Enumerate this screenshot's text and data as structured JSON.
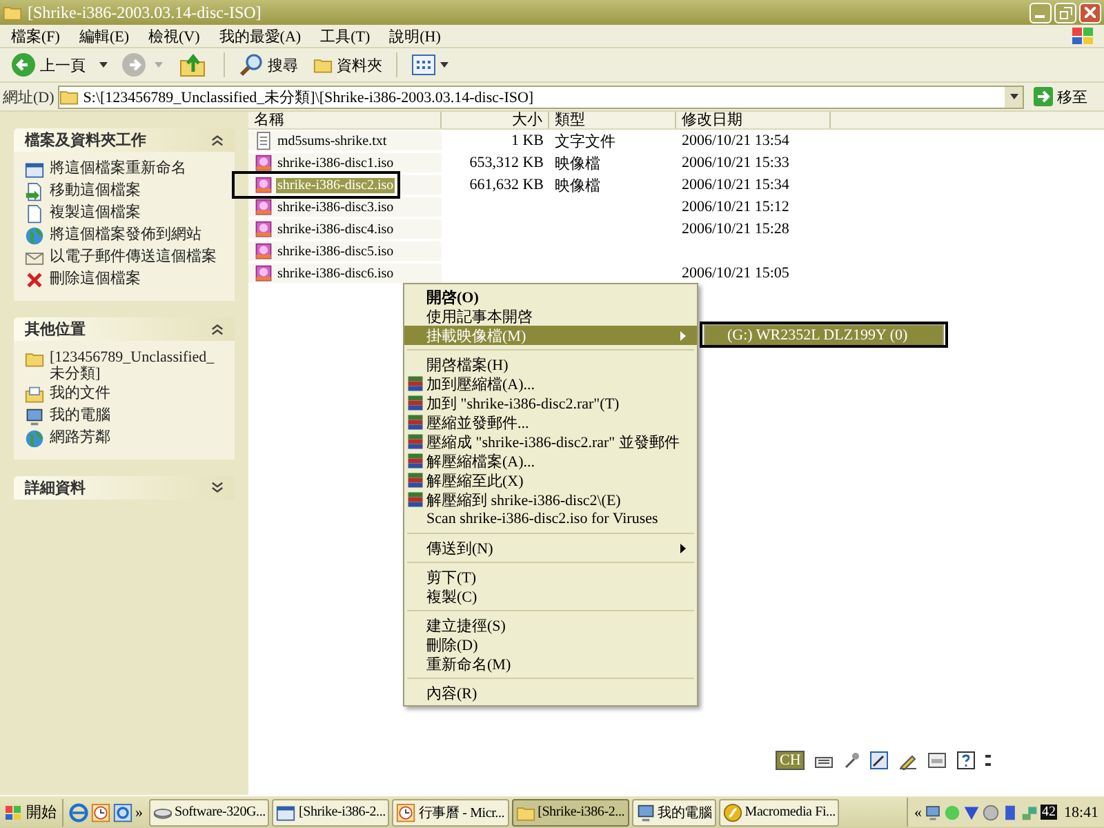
{
  "window": {
    "title": "[Shrike-i386-2003.03.14-disc-ISO]"
  },
  "menu_bar": [
    "檔案(F)",
    "編輯(E)",
    "檢視(V)",
    "我的最愛(A)",
    "工具(T)",
    "說明(H)"
  ],
  "toolbar": {
    "back": "上一頁",
    "search": "搜尋",
    "folders": "資料夾"
  },
  "address_bar": {
    "label": "網址(D)",
    "value": "S:\\[123456789_Unclassified_未分類]\\[Shrike-i386-2003.03.14-disc-ISO]",
    "go": "移至"
  },
  "side_panel": {
    "sections": [
      {
        "title": "檔案及資料夾工作",
        "expanded": true,
        "items": [
          "將這個檔案重新命名",
          "移動這個檔案",
          "複製這個檔案",
          "將這個檔案發佈到網站",
          "以電子郵件傳送這個檔案",
          "刪除這個檔案"
        ]
      },
      {
        "title": "其他位置",
        "expanded": true,
        "items": [
          "[123456789_Unclassified_未分類]",
          "我的文件",
          "我的電腦",
          "網路芳鄰"
        ]
      },
      {
        "title": "詳細資料",
        "expanded": false
      }
    ]
  },
  "file_list": {
    "columns": [
      "名稱",
      "大小",
      "類型",
      "修改日期"
    ],
    "rows": [
      {
        "name": "md5sums-shrike.txt",
        "kind": "text",
        "size": "1 KB",
        "type": "文字文件",
        "modified": "2006/10/21 13:54",
        "selected": false
      },
      {
        "name": "shrike-i386-disc1.iso",
        "kind": "disc-image",
        "size": "653,312 KB",
        "type": "映像檔",
        "modified": "2006/10/21 15:33",
        "selected": false
      },
      {
        "name": "shrike-i386-disc2.iso",
        "kind": "disc-image",
        "size": "661,632 KB",
        "type": "映像檔",
        "modified": "2006/10/21 15:34",
        "selected": true
      },
      {
        "name": "shrike-i386-disc3.iso",
        "kind": "disc-image",
        "modified": "2006/10/21 15:12",
        "selected": false
      },
      {
        "name": "shrike-i386-disc4.iso",
        "kind": "disc-image",
        "modified": "2006/10/21 15:28",
        "selected": false
      },
      {
        "name": "shrike-i386-disc5.iso",
        "kind": "disc-image",
        "selected": false
      },
      {
        "name": "shrike-i386-disc6.iso",
        "kind": "disc-image",
        "modified": "2006/10/21 15:05",
        "selected": false
      }
    ]
  },
  "context_menu": {
    "items": [
      {
        "label": "開啓(O)",
        "kind": "default",
        "selected": false
      },
      {
        "label": "使用記事本開啓",
        "kind": "plain",
        "selected": false
      },
      {
        "label": "掛載映像檔(M)",
        "kind": "submenu",
        "selected": true
      },
      {
        "kind": "separator"
      },
      {
        "label": "開啓檔案(H)",
        "kind": "plain",
        "selected": false
      },
      {
        "label": "加到壓縮檔(A)...",
        "kind": "archive",
        "selected": false
      },
      {
        "label": "加到 \"shrike-i386-disc2.rar\"(T)",
        "kind": "archive",
        "selected": false
      },
      {
        "label": "壓縮並發郵件...",
        "kind": "archive",
        "selected": false
      },
      {
        "label": "壓縮成 \"shrike-i386-disc2.rar\" 並發郵件",
        "kind": "archive",
        "selected": false
      },
      {
        "label": "解壓縮檔案(A)...",
        "kind": "archive",
        "selected": false
      },
      {
        "label": "解壓縮至此(X)",
        "kind": "archive",
        "selected": false
      },
      {
        "label": "解壓縮到 shrike-i386-disc2\\(E)",
        "kind": "archive",
        "selected": false
      },
      {
        "label": "Scan shrike-i386-disc2.iso for Viruses",
        "kind": "plain",
        "selected": false
      },
      {
        "kind": "separator"
      },
      {
        "label": "傳送到(N)",
        "kind": "submenu",
        "selected": false
      },
      {
        "kind": "separator"
      },
      {
        "label": "剪下(T)",
        "kind": "plain",
        "selected": false
      },
      {
        "label": "複製(C)",
        "kind": "plain",
        "selected": false
      },
      {
        "kind": "separator"
      },
      {
        "label": "建立捷徑(S)",
        "kind": "plain",
        "selected": false
      },
      {
        "label": "刪除(D)",
        "kind": "plain",
        "selected": false
      },
      {
        "label": "重新命名(M)",
        "kind": "plain",
        "selected": false
      },
      {
        "kind": "separator"
      },
      {
        "label": "內容(R)",
        "kind": "plain",
        "selected": false
      }
    ]
  },
  "submenu": {
    "items": [
      {
        "label": "(G:) WR2352L DLZ199Y (0)",
        "selected": true
      }
    ]
  },
  "language_bar": {
    "label": "CH"
  },
  "taskbar": {
    "start": "開始",
    "overflow": "»",
    "tasks": [
      {
        "label": "Software-320G...",
        "selected": false
      },
      {
        "label": "[Shrike-i386-2...",
        "selected": false
      },
      {
        "label": "行事曆 - Micr...",
        "selected": false
      },
      {
        "label": "[Shrike-i386-2...",
        "selected": true
      },
      {
        "label": "我的電腦",
        "selected": false
      },
      {
        "label": "Macromedia Fi...",
        "selected": false
      }
    ],
    "tray": {
      "overflow": "«",
      "badge": "42",
      "clock": "18:41"
    }
  }
}
